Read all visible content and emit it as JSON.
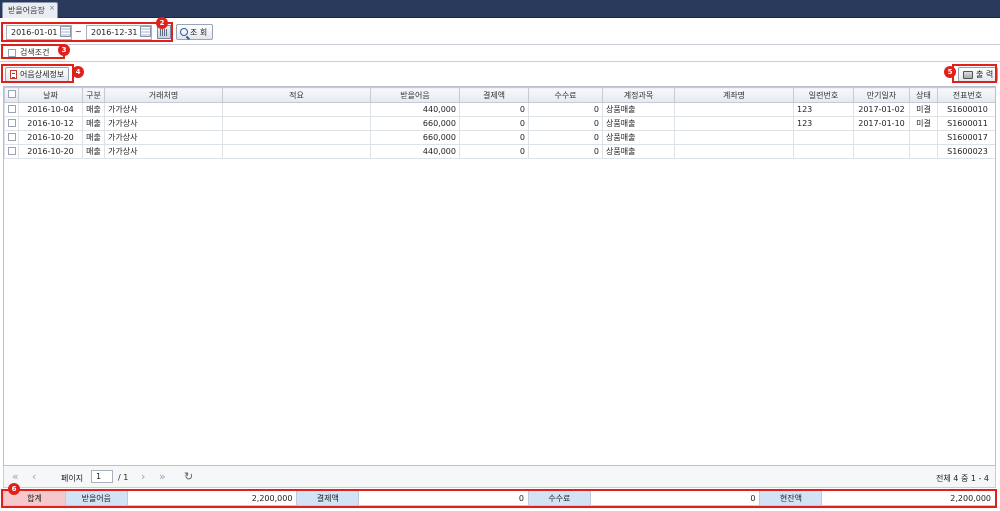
{
  "tab": {
    "title": "받을어음장",
    "close": "×"
  },
  "filter": {
    "date_from": "2016-01-01",
    "tilde": "~",
    "date_to": "2016-12-31",
    "search_label": "조 회"
  },
  "condition": {
    "label": "검색조건"
  },
  "toolbar": {
    "detail_label": "어음상세정보",
    "print_label": "출 력"
  },
  "badges": [
    "2",
    "3",
    "4",
    "5",
    "6"
  ],
  "table": {
    "headers": [
      "",
      "날짜",
      "구분",
      "거래처명",
      "적요",
      "받을어음",
      "결제액",
      "수수료",
      "계정과목",
      "계좌명",
      "일련번호",
      "만기일자",
      "상태",
      "전표번호"
    ],
    "rows": [
      [
        "",
        "2016-10-04",
        "매출",
        "가가상사",
        "",
        "440,000",
        "0",
        "0",
        "상품매출",
        "",
        "123",
        "2017-01-02",
        "미결",
        "S1600010"
      ],
      [
        "",
        "2016-10-12",
        "매출",
        "가가상사",
        "",
        "660,000",
        "0",
        "0",
        "상품매출",
        "",
        "123",
        "2017-01-10",
        "미결",
        "S1600011"
      ],
      [
        "",
        "2016-10-20",
        "매출",
        "가가상사",
        "",
        "660,000",
        "0",
        "0",
        "상품매출",
        "",
        "",
        "",
        "",
        "S1600017"
      ],
      [
        "",
        "2016-10-20",
        "매출",
        "가가상사",
        "",
        "440,000",
        "0",
        "0",
        "상품매출",
        "",
        "",
        "",
        "",
        "S1600023"
      ]
    ]
  },
  "pager": {
    "first": "«",
    "prev": "‹",
    "page_label": "페이지",
    "page_value": "1",
    "total_pages": "/ 1",
    "next": "›",
    "last": "»",
    "refresh": "↻",
    "info": "전체 4 중 1 - 4"
  },
  "summary": {
    "total_label": "합계",
    "bill_label": "받을어음",
    "bill_value": "2,200,000",
    "paid_label": "결제액",
    "paid_value": "0",
    "fee_label": "수수료",
    "fee_value": "0",
    "balance_label": "현잔액",
    "balance_value": "2,200,000"
  },
  "colors": {
    "topbar": "#2a3a5c",
    "highlight": "#e0201b",
    "total_bg": "#f6c7cb",
    "label_bg": "#d3e3f6"
  }
}
